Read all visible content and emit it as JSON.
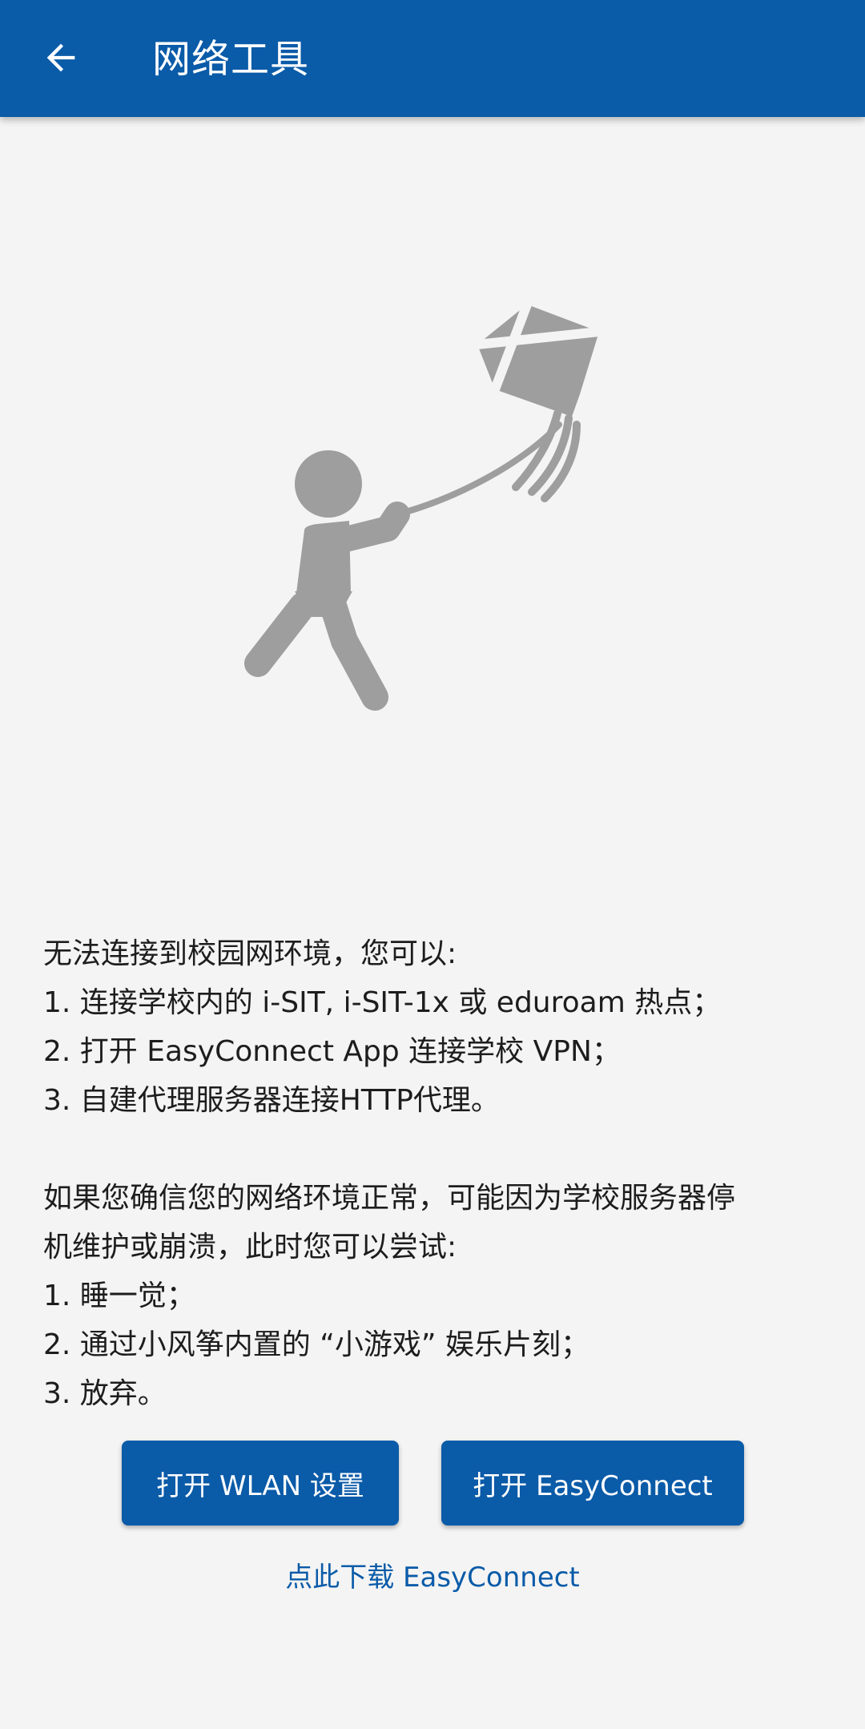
{
  "appbar": {
    "title": "网络工具",
    "back_icon": "arrow-left-icon",
    "background": "#0a5ba8"
  },
  "illustration": {
    "icon": "child-flying-kite-icon",
    "color": "#9e9e9e"
  },
  "message": {
    "lines": [
      "无法连接到校园网环境，您可以:",
      "1. 连接学校内的 i-SIT, i-SIT-1x 或 eduroam 热点；",
      "2. 打开 EasyConnect App 连接学校 VPN；",
      "3. 自建代理服务器连接HTTP代理。",
      "",
      "如果您确信您的网络环境正常，可能因为学校服务器停",
      "机维护或崩溃，此时您可以尝试:",
      "1. 睡一觉；",
      "2. 通过小风筝内置的 “小游戏” 娱乐片刻；",
      "3. 放弃。"
    ]
  },
  "buttons": {
    "open_wlan": "打开 WLAN 设置",
    "open_easyconnect": "打开 EasyConnect"
  },
  "download_link": "点此下载 EasyConnect",
  "colors": {
    "primary": "#0a5ba8",
    "background": "#f4f4f4",
    "text": "#1d1d1d"
  }
}
